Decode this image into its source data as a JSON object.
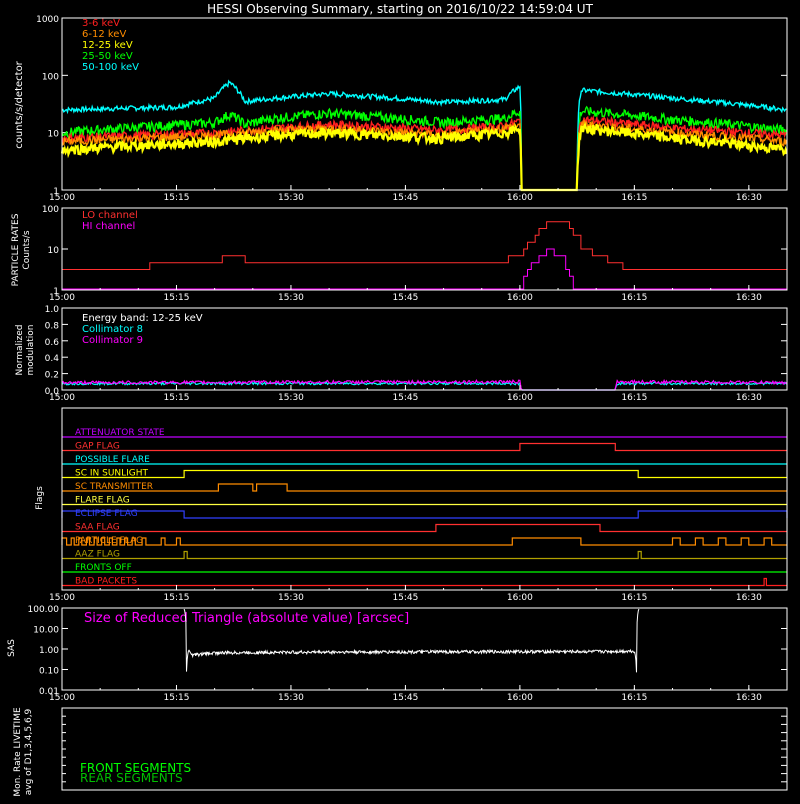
{
  "title": "HESSI Observing Summary, starting on 2016/10/22 14:59:04 UT",
  "time_ticks": [
    "15:00",
    "15:15",
    "15:30",
    "15:45",
    "16:00",
    "16:15",
    "16:30"
  ],
  "colors": {
    "frame": "#ffffff",
    "e3_6": "#ff2020",
    "e6_12": "#ff8c00",
    "e12_25": "#ffff00",
    "e25_50": "#00ff00",
    "e50_100": "#00ffff",
    "lo": "#ff3030",
    "hi": "#ff00ff",
    "coll8": "#00ffff",
    "coll9": "#ff00ff",
    "sas": "#ffffff",
    "sas_label": "#ff00ff",
    "front": "#00ff00",
    "rear": "#00c000"
  },
  "chart_data": [
    {
      "type": "line",
      "panel": "count-rates",
      "ylabel": "counts/s/detector",
      "yscale": "log",
      "ylim": [
        1,
        1000
      ],
      "yticks": [
        "1",
        "10",
        "100",
        "1000"
      ],
      "x_unit": "UT minutes after 15:00",
      "xlim": [
        0,
        95
      ],
      "gap": [
        0,
        60.2,
        67.5
      ],
      "series": [
        {
          "name": "3-6 keV",
          "color": "#ff2020",
          "x": [
            0,
            20,
            28,
            35,
            50,
            58,
            60,
            60.2,
            67.5,
            68,
            80,
            95
          ],
          "y": [
            8,
            10,
            12,
            14,
            11,
            13,
            16,
            1,
            1,
            17,
            12,
            9
          ]
        },
        {
          "name": "6-12 keV",
          "color": "#ff8c00",
          "x": [
            0,
            20,
            28,
            35,
            50,
            58,
            60,
            60.2,
            67.5,
            68,
            80,
            95
          ],
          "y": [
            7,
            9,
            11,
            12,
            9,
            12,
            14,
            1,
            1,
            14,
            10,
            7
          ]
        },
        {
          "name": "12-25 keV",
          "color": "#ffff00",
          "x": [
            0,
            20,
            28,
            35,
            50,
            58,
            60,
            60.2,
            67.5,
            68,
            80,
            95
          ],
          "y": [
            5,
            7,
            9,
            10,
            8,
            10,
            12,
            1,
            1,
            12,
            8,
            5
          ]
        },
        {
          "name": "25-50 keV",
          "color": "#00ff00",
          "x": [
            0,
            20,
            22,
            24,
            28,
            35,
            50,
            58,
            60,
            60.2,
            67.5,
            68,
            80,
            95
          ],
          "y": [
            10,
            15,
            21,
            14,
            18,
            22,
            15,
            18,
            24,
            1,
            1,
            24,
            17,
            11
          ]
        },
        {
          "name": "50-100 keV",
          "color": "#00ffff",
          "x": [
            0,
            15,
            20,
            22,
            24,
            28,
            35,
            50,
            58,
            60,
            60.2,
            67.5,
            68,
            80,
            95
          ],
          "y": [
            25,
            28,
            40,
            75,
            35,
            40,
            48,
            34,
            38,
            64,
            1,
            1,
            55,
            40,
            25
          ]
        }
      ]
    },
    {
      "type": "line",
      "panel": "particle-rates",
      "ylabel": "PARTICLE RATES Counts/s",
      "yscale": "log",
      "ylim": [
        1,
        100
      ],
      "yticks": [
        "1",
        "10",
        "100"
      ],
      "xlim": [
        0,
        95
      ],
      "series": [
        {
          "name": "LO channel",
          "color": "#ff3030",
          "x": [
            0,
            20,
            22,
            24,
            27,
            35,
            45,
            58,
            60,
            62,
            63,
            64,
            65,
            66,
            67,
            68,
            70,
            72,
            75,
            95
          ],
          "y": [
            3,
            4.5,
            8,
            5.5,
            5,
            4,
            4,
            5,
            8,
            20,
            35,
            48,
            50,
            40,
            25,
            12,
            7,
            4.5,
            3,
            3
          ]
        },
        {
          "name": "HI channel",
          "color": "#ff00ff",
          "x": [
            0,
            60,
            60.5,
            61.5,
            62.5,
            63.5,
            64.5,
            65.5,
            66,
            66.5,
            67,
            95
          ],
          "y": [
            1,
            1,
            2,
            4,
            7,
            9,
            8,
            6,
            3.5,
            2,
            1,
            1
          ]
        }
      ]
    },
    {
      "type": "line",
      "panel": "modulation",
      "ylabel": "Normalized modulation",
      "ylim": [
        0,
        1
      ],
      "yticks": [
        "0.0",
        "0.2",
        "0.4",
        "0.6",
        "0.8",
        "1.0"
      ],
      "annotation": "Energy band: 12-25 keV",
      "xlim": [
        0,
        95
      ],
      "series": [
        {
          "name": "Collimator 8",
          "color": "#00ffff",
          "x": [
            0,
            60,
            60.2,
            72.5,
            72.7,
            95
          ],
          "y": [
            0.08,
            0.08,
            0,
            0,
            0.08,
            0.08
          ]
        },
        {
          "name": "Collimator 9",
          "color": "#ff00ff",
          "x": [
            0,
            60,
            60.2,
            72.5,
            72.7,
            95
          ],
          "y": [
            0.09,
            0.1,
            0,
            0,
            0.1,
            0.09
          ]
        }
      ]
    },
    {
      "type": "line",
      "panel": "flags",
      "ylabel": "Flags",
      "xlim": [
        0,
        95
      ],
      "flags": [
        {
          "name": "ATTENUATOR STATE",
          "color": "#c000ff",
          "on": []
        },
        {
          "name": "GAP FLAG",
          "color": "#ff3030",
          "on": [
            [
              60,
              72.5
            ]
          ]
        },
        {
          "name": "POSSIBLE FLARE",
          "color": "#00ffff",
          "on": []
        },
        {
          "name": "SC IN SUNLIGHT",
          "color": "#ffff00",
          "on": [
            [
              16,
              75.5
            ]
          ]
        },
        {
          "name": "SC TRANSMITTER",
          "color": "#ff8c00",
          "on": [
            [
              20.5,
              25
            ],
            [
              25.5,
              29.5
            ]
          ]
        },
        {
          "name": "FLARE FLAG",
          "color": "#ffff40",
          "on": []
        },
        {
          "name": "ECLIPSE FLAG",
          "color": "#3040ff",
          "on": [
            [
              0,
              16
            ],
            [
              75.5,
              95
            ]
          ]
        },
        {
          "name": "SAA FLAG",
          "color": "#ff3030",
          "on": [
            [
              49,
              70.5
            ]
          ]
        },
        {
          "name": "PARTICLE FLAG",
          "color": "#ff8c00",
          "on": [
            [
              0,
              0.6
            ],
            [
              1.2,
              1.6
            ],
            [
              2.2,
              2.6
            ],
            [
              3.2,
              3.6
            ],
            [
              4.2,
              4.6
            ],
            [
              5.2,
              5.6
            ],
            [
              6.2,
              6.6
            ],
            [
              7.2,
              7.6
            ],
            [
              8.2,
              8.6
            ],
            [
              9.2,
              9.6
            ],
            [
              10.5,
              11
            ],
            [
              13,
              13.5
            ],
            [
              15,
              15.5
            ],
            [
              59,
              68
            ],
            [
              80,
              81
            ],
            [
              83,
              84
            ],
            [
              86,
              87
            ],
            [
              89,
              90
            ],
            [
              92,
              93
            ]
          ]
        },
        {
          "name": "AAZ FLAG",
          "color": "#b0a000",
          "on": [
            [
              16,
              16.4
            ],
            [
              75.5,
              75.9
            ]
          ]
        },
        {
          "name": "FRONTS OFF",
          "color": "#00ff00",
          "on": []
        },
        {
          "name": "BAD PACKETS",
          "color": "#ff2020",
          "on": [
            [
              92,
              92.3
            ]
          ]
        }
      ]
    },
    {
      "type": "line",
      "panel": "sas",
      "ylabel": "SAS",
      "yscale": "log",
      "ylim": [
        0.01,
        100
      ],
      "yticks": [
        "0.01",
        "0.10",
        "1.00",
        "10.00",
        "100.00"
      ],
      "annotation": "Size of Reduced Triangle (absolute value) [arcsec]",
      "xlim": [
        0,
        95
      ],
      "series": [
        {
          "name": "",
          "color": "#ffffff",
          "x": [
            16,
            16.3,
            16.6,
            17,
            20,
            30,
            45,
            60,
            70,
            75,
            75.3,
            75.6
          ],
          "y": [
            100,
            0.02,
            0.9,
            0.5,
            0.65,
            0.7,
            0.72,
            0.75,
            0.75,
            0.8,
            0.02,
            100
          ]
        }
      ]
    },
    {
      "type": "line",
      "panel": "livetime",
      "ylabel": "Mon. Rate LIVETIME avg of D1,3,4,5,6,9",
      "xlim": [
        0,
        95
      ],
      "legend": [
        "FRONT SEGMENTS",
        "REAR SEGMENTS"
      ]
    }
  ],
  "labels": {
    "ylabel_counts": "counts/s/detector",
    "ylabel_particle_1": "PARTICLE RATES",
    "ylabel_particle_2": "Counts/s",
    "ylabel_mod_1": "Normalized",
    "ylabel_mod_2": "modulation",
    "ylabel_flags": "Flags",
    "ylabel_sas": "SAS",
    "ylabel_live_1": "Mon. Rate LIVETIME",
    "ylabel_live_2": "avg of D1,3,4,5,6,9",
    "energy_band": "Energy band: 12-25 keV",
    "sas_title": "Size of Reduced Triangle (absolute value) [arcsec]",
    "front_segments": "FRONT SEGMENTS",
    "rear_segments": "REAR SEGMENTS"
  }
}
